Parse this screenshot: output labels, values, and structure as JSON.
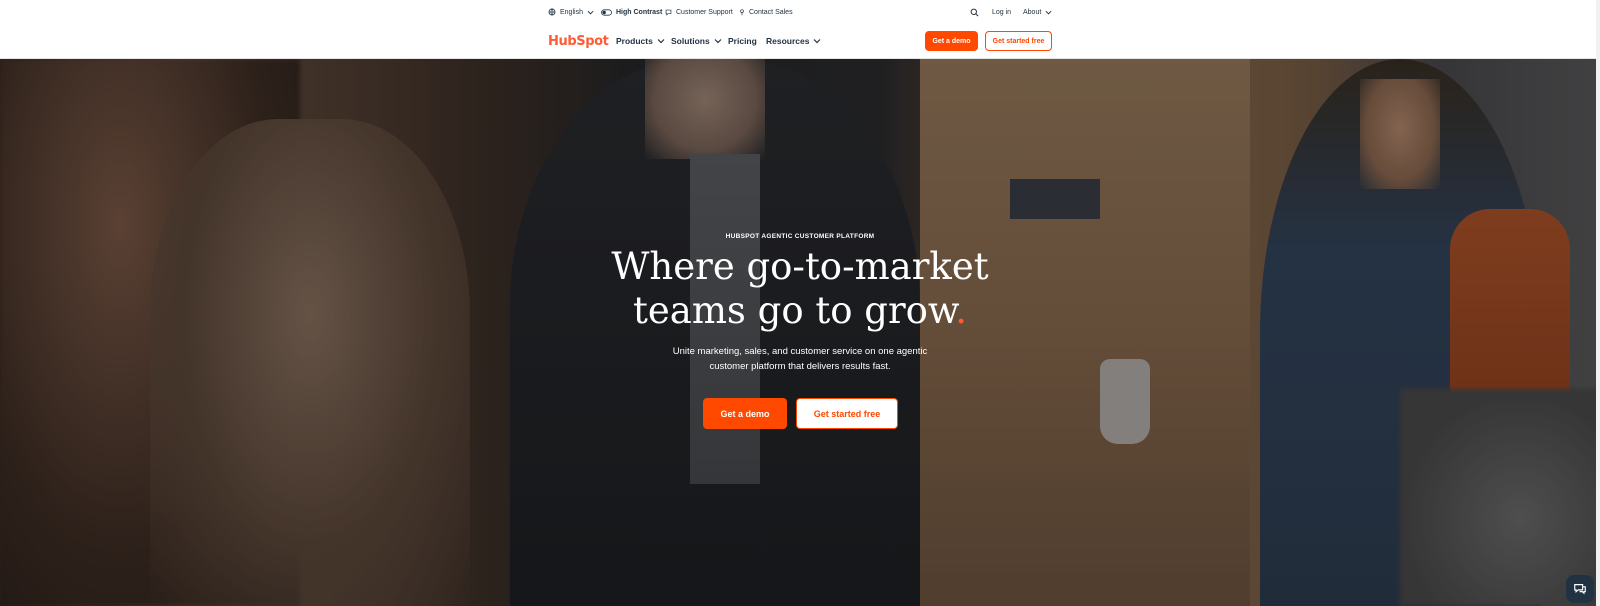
{
  "colors": {
    "brand": "#ff4800",
    "brand_light": "#ff5c35",
    "text_dark": "#213343"
  },
  "utility_bar": {
    "language": {
      "label": "English",
      "icon": "globe-icon"
    },
    "high_contrast": {
      "label": "High Contrast",
      "icon": "toggle-icon"
    },
    "customer_support": {
      "label": "Customer Support",
      "icon": "chat-icon"
    },
    "contact_sales": {
      "label": "Contact Sales",
      "icon": "person-icon"
    },
    "search_icon": "search-icon",
    "login": "Log in",
    "about": "About"
  },
  "main_nav": {
    "logo": "HubSpot",
    "items": [
      {
        "label": "Products",
        "has_dropdown": true
      },
      {
        "label": "Solutions",
        "has_dropdown": true
      },
      {
        "label": "Pricing",
        "has_dropdown": false
      },
      {
        "label": "Resources",
        "has_dropdown": true
      }
    ],
    "cta_demo": "Get a demo",
    "cta_free": "Get started free"
  },
  "hero": {
    "eyebrow": "HUBSPOT AGENTIC CUSTOMER PLATFORM",
    "headline_line1": "Where go-to-market",
    "headline_line2": "teams go to grow",
    "headline_dot": ".",
    "subtext_line1": "Unite marketing, sales, and customer service on one agentic",
    "subtext_line2": "customer platform that delivers results fast.",
    "cta_demo": "Get a demo",
    "cta_free": "Get started free"
  },
  "chat_widget": {
    "icon": "chat-bubble-icon"
  }
}
